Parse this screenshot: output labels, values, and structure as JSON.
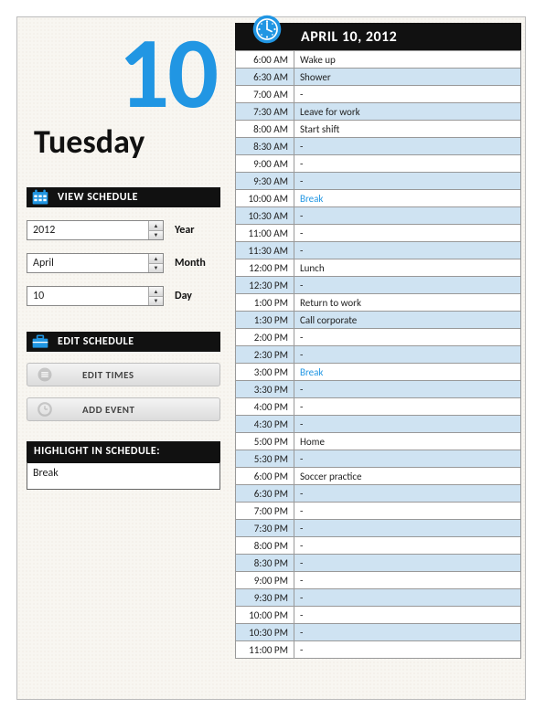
{
  "date": {
    "big_number": "10",
    "day_name": "Tuesday",
    "full": "APRIL 10, 2012"
  },
  "sections": {
    "view": "VIEW SCHEDULE",
    "edit": "EDIT SCHEDULE",
    "highlight": "HIGHLIGHT IN SCHEDULE:"
  },
  "controls": {
    "year": {
      "value": "2012",
      "label": "Year"
    },
    "month": {
      "value": "April",
      "label": "Month"
    },
    "day": {
      "value": "10",
      "label": "Day"
    }
  },
  "buttons": {
    "edit_times": "EDIT TIMES",
    "add_event": "ADD EVENT"
  },
  "highlight_value": "Break",
  "schedule": [
    {
      "time": "6:00 AM",
      "event": "Wake up",
      "alt": false
    },
    {
      "time": "6:30 AM",
      "event": "Shower",
      "alt": true
    },
    {
      "time": "7:00 AM",
      "event": "-",
      "alt": false
    },
    {
      "time": "7:30 AM",
      "event": "Leave for work",
      "alt": true
    },
    {
      "time": "8:00 AM",
      "event": "Start shift",
      "alt": false
    },
    {
      "time": "8:30 AM",
      "event": "-",
      "alt": true
    },
    {
      "time": "9:00 AM",
      "event": "-",
      "alt": false
    },
    {
      "time": "9:30 AM",
      "event": "-",
      "alt": true
    },
    {
      "time": "10:00 AM",
      "event": "Break",
      "alt": false,
      "hl": true
    },
    {
      "time": "10:30 AM",
      "event": "-",
      "alt": true
    },
    {
      "time": "11:00 AM",
      "event": "-",
      "alt": false
    },
    {
      "time": "11:30 AM",
      "event": "-",
      "alt": true
    },
    {
      "time": "12:00 PM",
      "event": "Lunch",
      "alt": false
    },
    {
      "time": "12:30 PM",
      "event": "-",
      "alt": true
    },
    {
      "time": "1:00 PM",
      "event": "Return to work",
      "alt": false
    },
    {
      "time": "1:30 PM",
      "event": "Call corporate",
      "alt": true
    },
    {
      "time": "2:00 PM",
      "event": "-",
      "alt": false
    },
    {
      "time": "2:30 PM",
      "event": "-",
      "alt": true
    },
    {
      "time": "3:00 PM",
      "event": "Break",
      "alt": false,
      "hl": true
    },
    {
      "time": "3:30 PM",
      "event": "-",
      "alt": true
    },
    {
      "time": "4:00 PM",
      "event": "-",
      "alt": false
    },
    {
      "time": "4:30 PM",
      "event": "-",
      "alt": true
    },
    {
      "time": "5:00 PM",
      "event": "Home",
      "alt": false
    },
    {
      "time": "5:30 PM",
      "event": "-",
      "alt": true
    },
    {
      "time": "6:00 PM",
      "event": "Soccer practice",
      "alt": false
    },
    {
      "time": "6:30 PM",
      "event": "-",
      "alt": true
    },
    {
      "time": "7:00 PM",
      "event": "-",
      "alt": false
    },
    {
      "time": "7:30 PM",
      "event": "-",
      "alt": true
    },
    {
      "time": "8:00 PM",
      "event": "-",
      "alt": false
    },
    {
      "time": "8:30 PM",
      "event": "-",
      "alt": true
    },
    {
      "time": "9:00 PM",
      "event": "-",
      "alt": false
    },
    {
      "time": "9:30 PM",
      "event": "-",
      "alt": true
    },
    {
      "time": "10:00 PM",
      "event": "-",
      "alt": false
    },
    {
      "time": "10:30 PM",
      "event": "-",
      "alt": true
    },
    {
      "time": "11:00 PM",
      "event": "-",
      "alt": false
    }
  ]
}
